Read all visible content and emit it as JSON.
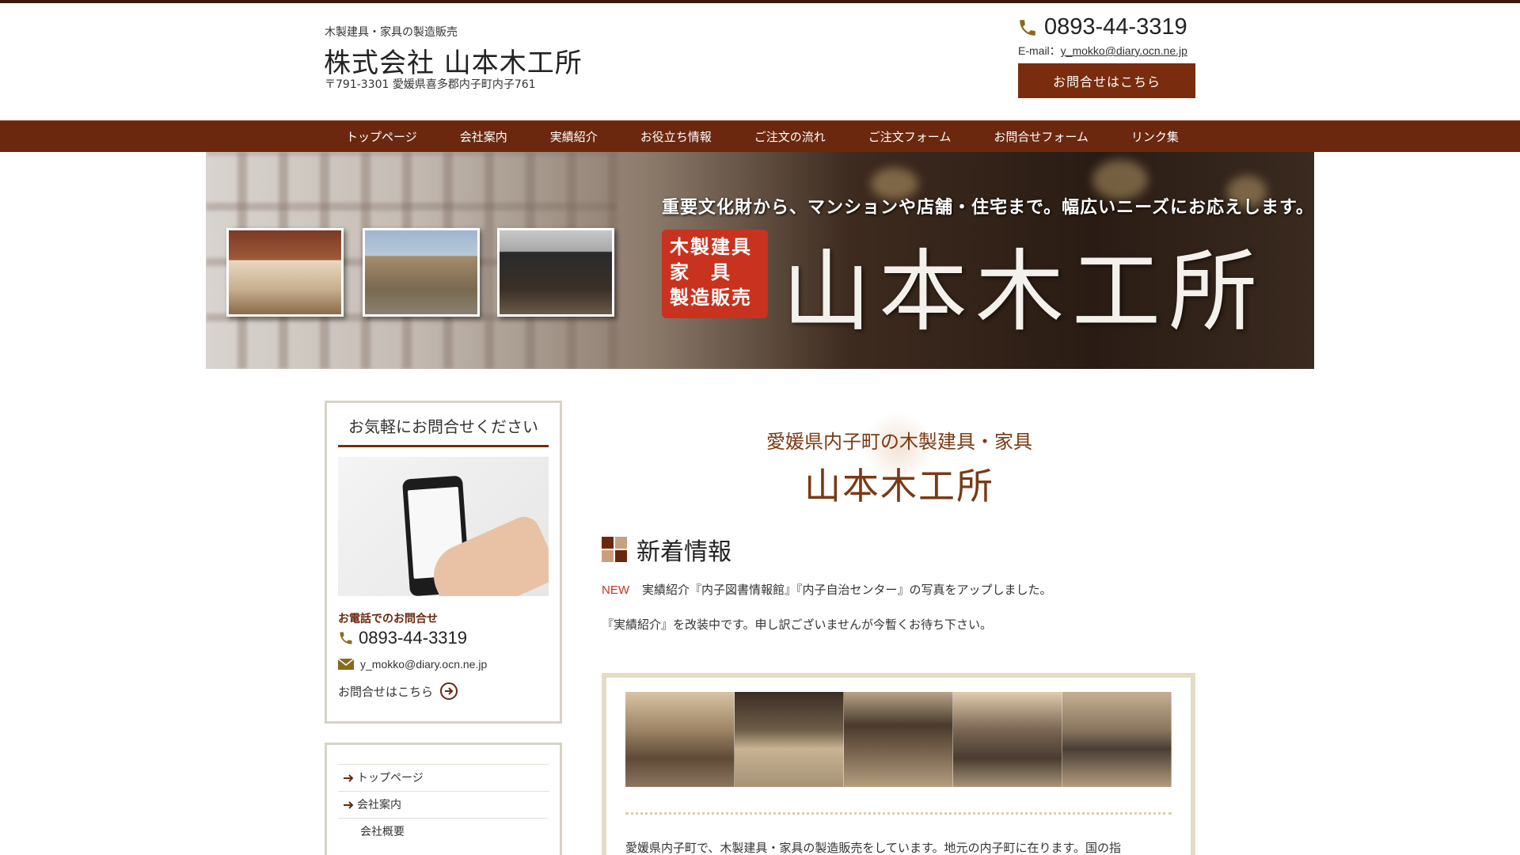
{
  "header": {
    "tagline": "木製建具・家具の製造販売",
    "company_name": "株式会社 山本木工所",
    "address": "〒791-3301 愛媛県喜多郡内子町内子761",
    "phone": "0893-44-3319",
    "email_label": "E-mail：",
    "email": "y_mokko@diary.ocn.ne.jp",
    "contact_button": "お問合せはこちら"
  },
  "nav": {
    "items": [
      {
        "label": "トップページ"
      },
      {
        "label": "会社案内"
      },
      {
        "label": "実績紹介"
      },
      {
        "label": "お役立ち情報"
      },
      {
        "label": "ご注文の流れ"
      },
      {
        "label": "ご注文フォーム"
      },
      {
        "label": "お問合せフォーム"
      },
      {
        "label": "リンク集"
      }
    ]
  },
  "hero": {
    "headline": "重要文化財から、マンションや店舗・住宅まで。幅広いニーズにお応えします。",
    "badge_lines": [
      "木製建具",
      "家　具",
      "製造販売"
    ],
    "name": "山本木工所"
  },
  "sidebar": {
    "contact_title": "お気軽にお問合せください",
    "tel_label": "お電話でのお問合せ",
    "phone": "0893-44-3319",
    "email": "y_mokko@diary.ocn.ne.jp",
    "inquiry_link": "お問合せはこちら",
    "menu": [
      {
        "label": "トップページ"
      },
      {
        "label": "会社案内"
      },
      {
        "label": "会社概要"
      }
    ]
  },
  "main": {
    "intro_sub": "愛媛県内子町の木製建具・家具",
    "intro_main": "山本木工所",
    "news_title": "新着情報",
    "news_new_tag": "NEW",
    "news_item_1": "実績紹介『内子図書情報館』『内子自治センター』の写真をアップしました。",
    "news_item_2": "『実績紹介』を改装中です。申し訳ございませんが今暫くお待ち下さい。",
    "frame_text": "愛媛県内子町で、木製建具・家具の製造販売をしています。地元の内子町に在ります。国の指"
  },
  "colors": {
    "brand": "#6b280f",
    "button": "#7a2c0e",
    "accent_text": "#7a3a14",
    "new_tag": "#c8321e",
    "frame_border": "#e4dcc4"
  },
  "icons": {
    "phone": "phone-icon",
    "mail": "mail-icon",
    "circle_arrow": "circle-arrow-icon",
    "menu_arrow": "arrow-right-icon",
    "news_squares": "squares-icon"
  }
}
